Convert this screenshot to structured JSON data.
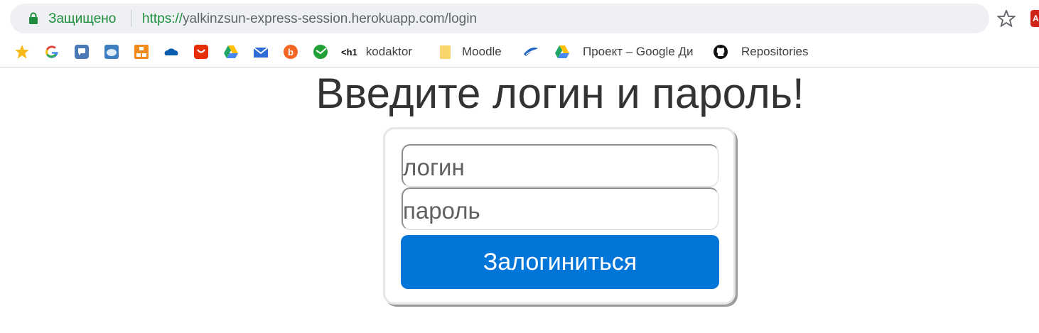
{
  "browser": {
    "secure_label": "Защищено",
    "url_scheme": "https://",
    "url_rest": "yalkinzsun-express-session.herokuapp.com/login",
    "bookmarks": [
      {
        "name": "bookmarks-star",
        "label": ""
      },
      {
        "name": "google",
        "label": ""
      },
      {
        "name": "chat",
        "label": ""
      },
      {
        "name": "cloud",
        "label": ""
      },
      {
        "name": "diagram",
        "label": ""
      },
      {
        "name": "onedrive",
        "label": ""
      },
      {
        "name": "aliexpress",
        "label": ""
      },
      {
        "name": "drive",
        "label": ""
      },
      {
        "name": "mail",
        "label": ""
      },
      {
        "name": "blogger",
        "label": ""
      },
      {
        "name": "sberbank",
        "label": ""
      },
      {
        "name": "h1",
        "label": "kodaktor"
      },
      {
        "name": "folder",
        "label": "Moodle"
      },
      {
        "name": "moodle-hat",
        "label": ""
      },
      {
        "name": "google-drive",
        "label": "Проект – Google Ди"
      },
      {
        "name": "github",
        "label": "Repositories"
      }
    ],
    "h1_glyph": "<h1"
  },
  "page": {
    "heading": "Введите логин и пароль!",
    "login_placeholder": "логин",
    "password_placeholder": "пароль",
    "submit_label": "Залогиниться"
  },
  "colors": {
    "secure_green": "#1e8e3e",
    "button_blue": "#0275d8"
  }
}
